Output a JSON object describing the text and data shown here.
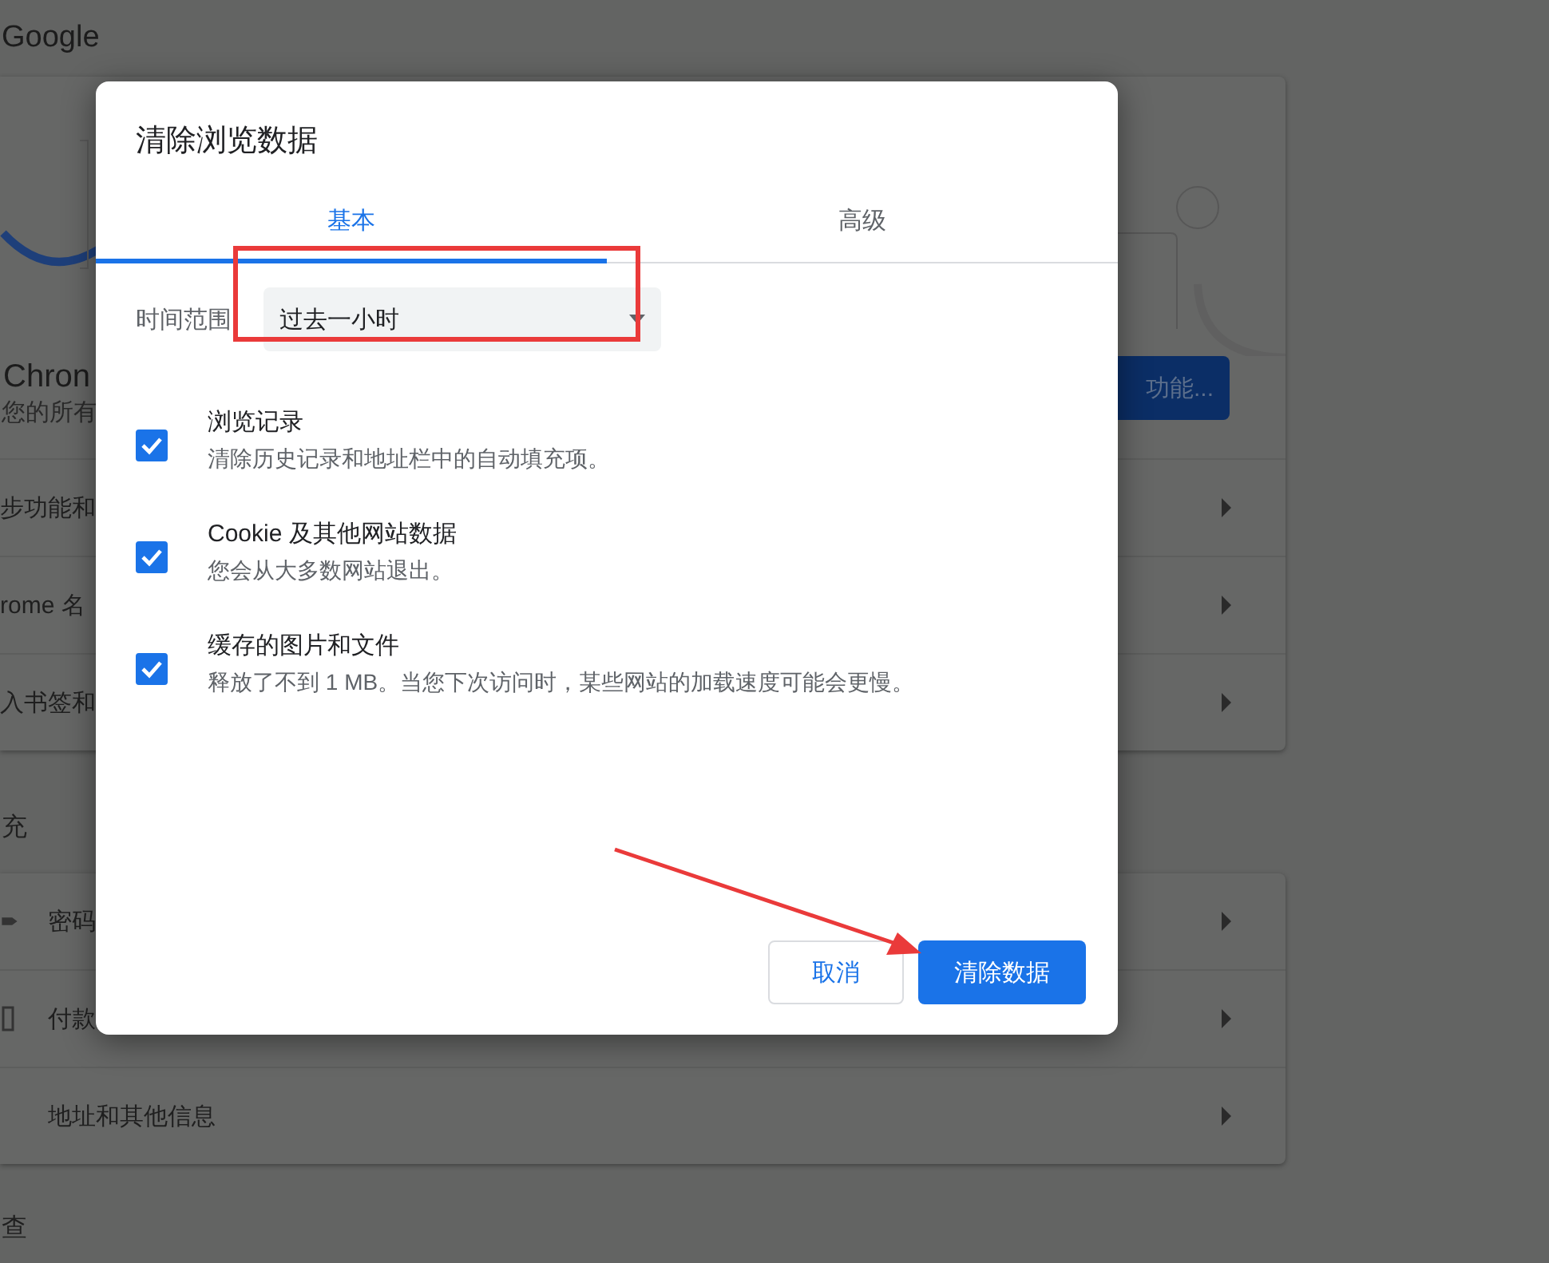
{
  "page": {
    "header": "Google",
    "card": {
      "heading": "Chron",
      "subtext": "您的所有",
      "button": "功能...",
      "rows": [
        "步功能和",
        "rome 名",
        "入书签和"
      ]
    },
    "section_label": "充",
    "autofill_rows": [
      {
        "label": "密码"
      },
      {
        "label": "付款"
      },
      {
        "label": "地址和其他信息"
      }
    ],
    "next_section": "查"
  },
  "dialog": {
    "title": "清除浏览数据",
    "tabs": [
      {
        "label": "基本",
        "selected": true
      },
      {
        "label": "高级",
        "selected": false
      }
    ],
    "time_range": {
      "label": "时间范围",
      "value": "过去一小时"
    },
    "options": [
      {
        "title": "浏览记录",
        "description": "清除历史记录和地址栏中的自动填充项。",
        "checked": true
      },
      {
        "title": "Cookie 及其他网站数据",
        "description": "您会从大多数网站退出。",
        "checked": true
      },
      {
        "title": "缓存的图片和文件",
        "description": "释放了不到 1 MB。当您下次访问时，某些网站的加载速度可能会更慢。",
        "checked": true
      }
    ],
    "buttons": [
      {
        "label": "取消",
        "kind": "secondary"
      },
      {
        "label": "清除数据",
        "kind": "primary"
      }
    ]
  }
}
